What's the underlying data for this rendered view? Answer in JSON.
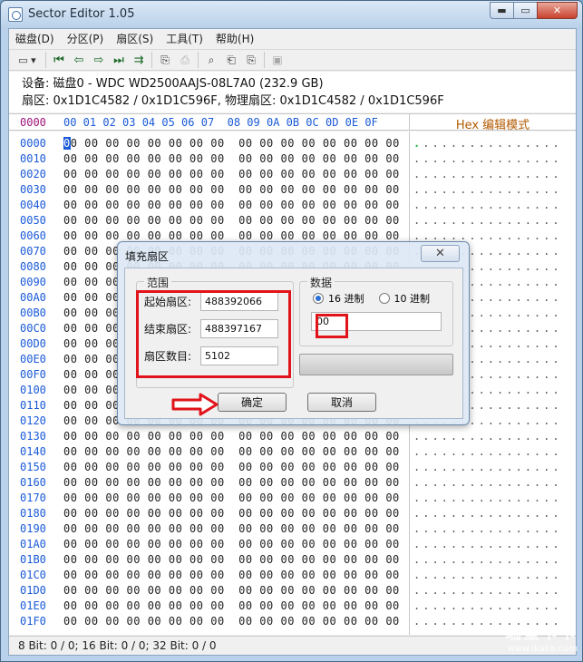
{
  "window": {
    "title": "Sector Editor 1.05",
    "min_glyph": "▬",
    "max_glyph": "▭",
    "close_glyph": "✕"
  },
  "menu": [
    "磁盘(D)",
    "分区(P)",
    "扇区(S)",
    "工具(T)",
    "帮助(H)"
  ],
  "info": {
    "line1": "设备: 磁盘0 - WDC WD2500AAJS-08L7A0 (232.9 GB)",
    "line2": "扇区: 0x1D1C4582 / 0x1D1C596F, 物理扇区: 0x1D1C4582 / 0x1D1C596F"
  },
  "hex": {
    "addr_header": "0000",
    "offsets": "00 01 02 03 04 05 06 07  08 09 0A 0B 0C 0D 0E 0F",
    "mode_label": "Hex 编辑模式",
    "row_bytes": "00 00 00 00 00 00 00 00  00 00 00 00 00 00 00 00",
    "first_byte_rest": "0 00 00 00 00 00 00 00  00 00 00 00 00 00 00 00",
    "ascii": "................",
    "addresses": [
      "0000",
      "0010",
      "0020",
      "0030",
      "0040",
      "0050",
      "0060",
      "0070",
      "0080",
      "0090",
      "00A0",
      "00B0",
      "00C0",
      "00D0",
      "00E0",
      "00F0",
      "0100",
      "0110",
      "0120",
      "0130",
      "0140",
      "0150",
      "0160",
      "0170",
      "0180",
      "0190",
      "01A0",
      "01B0",
      "01C0",
      "01D0",
      "01E0",
      "01F0"
    ]
  },
  "status": "8 Bit: 0 / 0;  16 Bit: 0 / 0;  32 Bit: 0 / 0",
  "watermark": {
    "line1": "瑞星卡卡",
    "line2": "www.ikaka.com"
  },
  "dialog": {
    "title": "填充扇区",
    "close_glyph": "✕",
    "range_group": "范围",
    "start_label": "起始扇区:",
    "start_value": "488392066",
    "end_label": "结束扇区:",
    "end_value": "488397167",
    "count_label": "扇区数目:",
    "count_value": "5102",
    "data_group": "数据",
    "radio_hex": "16 进制",
    "radio_dec": "10 进制",
    "selected_radix": "16 进制",
    "data_value": "00",
    "ok_label": "确定",
    "cancel_label": "取消"
  },
  "colors": {
    "annotation_red": "#e0141a",
    "address_blue": "#1a5ad8",
    "mode_orange": "#b25a00"
  }
}
